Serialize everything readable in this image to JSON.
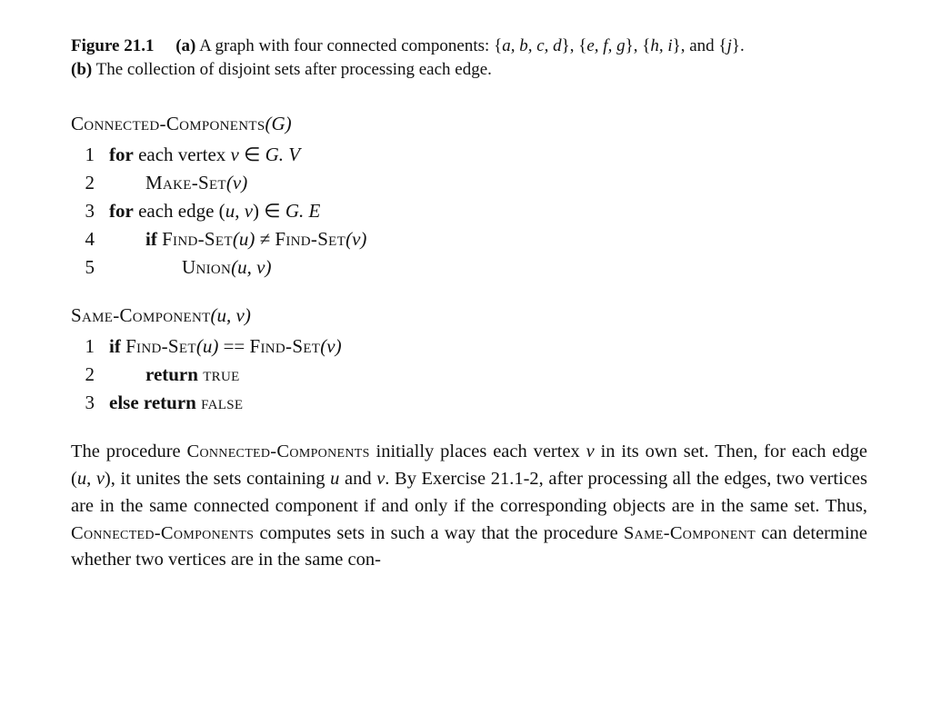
{
  "caption": {
    "label": "Figure 21.1",
    "part_a_label": "(a)",
    "part_a_text_1": " A graph with four connected components: {",
    "set1": "a, b, c, d",
    "sep1": "}, {",
    "set2": "e, f, g",
    "sep2": "}, {",
    "set3": "h, i",
    "sep3": "}, and {",
    "set4": "j",
    "part_a_close": "}.",
    "part_b_label": "(b)",
    "part_b_text": " The collection of disjoint sets after processing each edge."
  },
  "proc1": {
    "title_sc": "Connected-Components",
    "title_arg": "(G)",
    "l1": {
      "n": "1",
      "kw": "for",
      "t1": " each vertex ",
      "v": "v",
      "t2": " ∈ ",
      "gv": "G. V"
    },
    "l2": {
      "n": "2",
      "sc": "Make-Set",
      "arg": "(v)"
    },
    "l3": {
      "n": "3",
      "kw": "for",
      "t1": " each edge (",
      "u": "u",
      "c": ", ",
      "v": "v",
      "t2": ") ∈ ",
      "ge": "G. E"
    },
    "l4": {
      "n": "4",
      "kw": "if",
      "sp": " ",
      "sc1": "Find-Set",
      "a1": "(u)",
      "ne": " ≠ ",
      "sc2": "Find-Set",
      "a2": "(v)"
    },
    "l5": {
      "n": "5",
      "sc": "Union",
      "arg": "(u, v)"
    }
  },
  "proc2": {
    "title_sc": "Same-Component",
    "title_arg": "(u, v)",
    "l1": {
      "n": "1",
      "kw": "if",
      "sp": " ",
      "sc1": "Find-Set",
      "a1": "(u)",
      "eq": " == ",
      "sc2": "Find-Set",
      "a2": "(v)"
    },
    "l2": {
      "n": "2",
      "kw": "return",
      "sp": " ",
      "sc": "true"
    },
    "l3": {
      "n": "3",
      "kw1": "else",
      "sp": " ",
      "kw2": "return",
      "sp2": " ",
      "sc": "false"
    }
  },
  "para": {
    "t1": "The procedure ",
    "sc1": "Connected-Components",
    "t2": " initially places each vertex ",
    "v": "v",
    "t3": " in its own set.  Then, for each edge (",
    "u": "u",
    "c": ", ",
    "v2": "v",
    "t4": "), it unites the sets containing ",
    "u2": "u",
    "t5": " and ",
    "v3": "v",
    "t6": ".  By Exercise 21.1-2, after processing all the edges, two vertices are in the same connected component if and only if the corresponding objects are in the same set.  Thus, ",
    "sc2": "Connected-Components",
    "t7": " computes sets in such a way that the procedure ",
    "sc3": "Same-Component",
    "t8": " can determine whether two vertices are in the same con-"
  }
}
